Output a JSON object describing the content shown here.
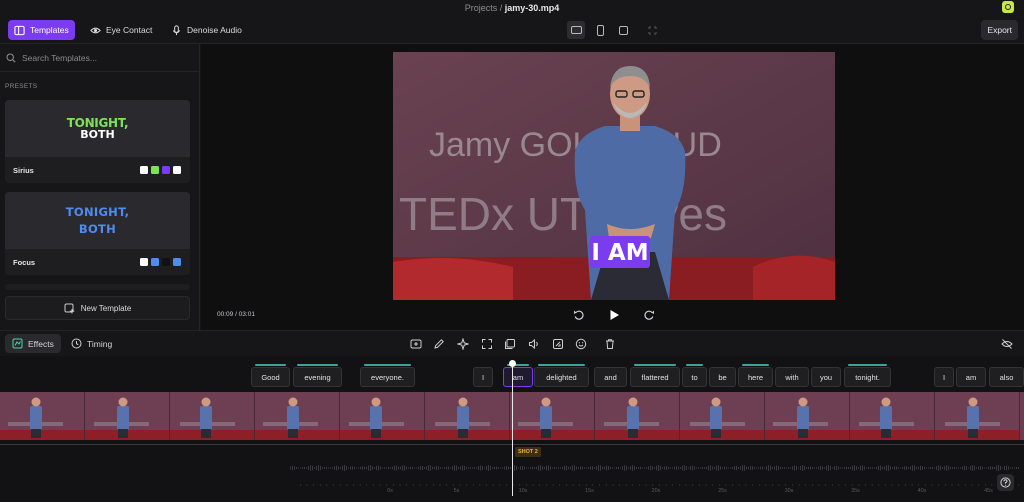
{
  "header": {
    "breadcrumb_root": "Projects",
    "breadcrumb_sep": "/",
    "file_name": "jamy-30.mp4",
    "tabs": [
      {
        "label": "Templates",
        "icon": "templates-icon",
        "active": true
      },
      {
        "label": "Eye Contact",
        "icon": "eye-contact-icon",
        "active": false
      },
      {
        "label": "Denoise Audio",
        "icon": "denoise-audio-icon",
        "active": false
      }
    ],
    "export_label": "Export",
    "accent_color": "#7b3cf0"
  },
  "sidebar": {
    "search_placeholder": "Search Templates...",
    "section_label": "PRESETS",
    "presets": [
      {
        "name": "Sirius",
        "preview_line1": "TONIGHT,",
        "preview_line2": "BOTH",
        "swatches": [
          "#ffffff",
          "#7de25a",
          "#7b3cf0",
          "#ffffff"
        ]
      },
      {
        "name": "Focus",
        "preview_line1": "TONIGHT,",
        "preview_line2": "BOTH",
        "swatches": [
          "#ffffff",
          "#4f8cf0",
          "#111111",
          "#4f8cf0"
        ]
      }
    ],
    "new_template_label": "New Template"
  },
  "player": {
    "caption_word": "I AM",
    "backdrop_name": "Jamy GOURMAUD",
    "backdrop_event": "TEDx UTTroyes",
    "timecode": "00:09 / 03:01"
  },
  "toolbar": {
    "tabs": [
      {
        "label": "Effects",
        "icon": "effects-icon",
        "active": true
      },
      {
        "label": "Timing",
        "icon": "clock-icon",
        "active": false
      }
    ]
  },
  "timeline": {
    "words": [
      "Good",
      "evening",
      "everyone.",
      "I",
      "am",
      "delighted",
      "and",
      "flattered",
      "to",
      "be",
      "here",
      "with",
      "you",
      "tonight.",
      "I",
      "am",
      "also"
    ],
    "current_word": "am",
    "shot_label": "SHOT 2",
    "ruler_ticks": [
      "0s",
      "5s",
      "10s",
      "15s",
      "20s",
      "25s",
      "30s",
      "35s",
      "40s",
      "45s"
    ]
  }
}
